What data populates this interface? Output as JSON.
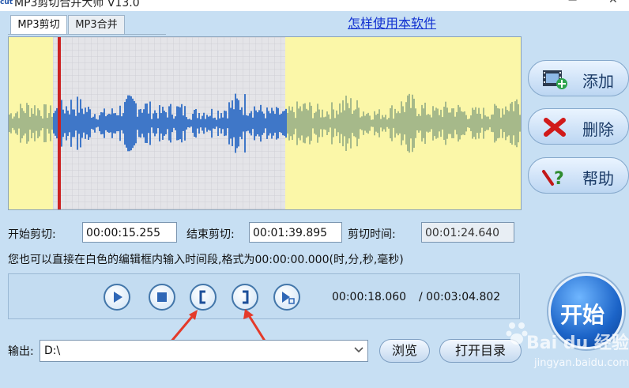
{
  "window": {
    "icon_text": "cut",
    "title": "MP3剪切合并大师 V13.0"
  },
  "tabs": [
    {
      "label": "MP3剪切"
    },
    {
      "label": "MP3合并"
    }
  ],
  "help_link": "怎样使用本软件",
  "side_buttons": {
    "add": "添加",
    "delete": "删除",
    "help": "帮助"
  },
  "cut": {
    "start_label": "开始剪切:",
    "start_value": "00:00:15.255",
    "end_label": "结束剪切:",
    "end_value": "00:01:39.895",
    "duration_label": "剪切时间:",
    "duration_value": "00:01:24.640",
    "hint": "您也可以直接在白色的编辑框内输入时间段,格式为00:00:00.000(时,分,秒,毫秒)"
  },
  "player": {
    "current_time": "00:00:18.060",
    "total_time": "/ 00:03:04.802"
  },
  "start_button": "开始",
  "output": {
    "label": "输出:",
    "path": "D:\\"
  },
  "buttons": {
    "browse": "浏览",
    "open_dir": "打开目录"
  },
  "watermark": {
    "brand": "Bai du 经验",
    "url": "jingyan.baidu.com"
  },
  "colors": {
    "background": "#c7dff3",
    "waveform_unselected": "#fbf7a8",
    "waveform_selected": "#e4e4e8",
    "wave_blue": "#3f77c8",
    "wave_green": "#a6b98a",
    "cursor": "#cc2222",
    "annotation_arrow": "#e43a2a"
  },
  "icons": {
    "add": "film-plus-icon",
    "delete": "red-x-icon",
    "help": "question-wand-icon",
    "play": "play-icon",
    "stop": "stop-icon",
    "mark_start": "bracket-open-icon",
    "mark_end": "bracket-close-icon",
    "preview_selection": "play-selection-icon",
    "dropdown": "chevron-down-icon"
  }
}
